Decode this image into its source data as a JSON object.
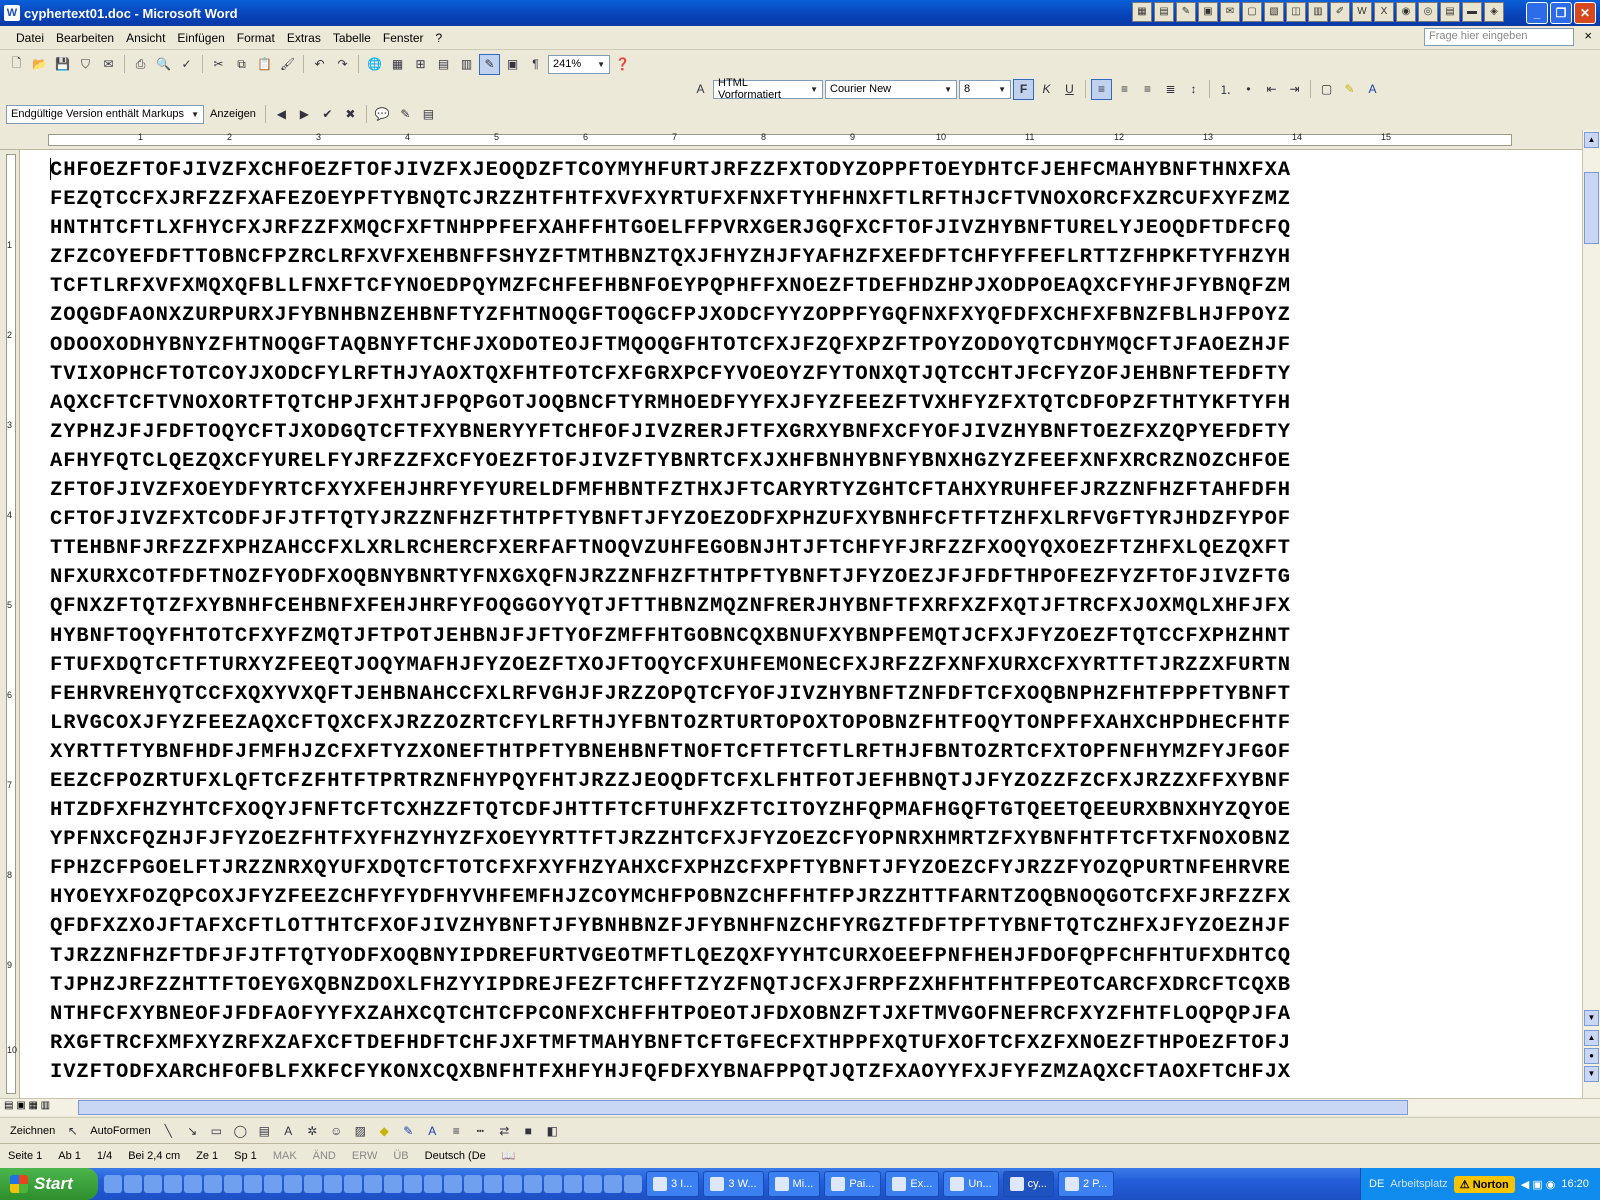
{
  "window": {
    "title": "cyphertext01.doc - Microsoft Word",
    "app_icon": "W"
  },
  "menu": [
    "Datei",
    "Bearbeiten",
    "Ansicht",
    "Einfügen",
    "Format",
    "Extras",
    "Tabelle",
    "Fenster",
    "?"
  ],
  "help": {
    "placeholder": "Frage hier eingeben",
    "close": "×"
  },
  "toolbar": {
    "zoom": "241%"
  },
  "formatting": {
    "style": "HTML Vorformatiert",
    "font": "Courier New",
    "size": "8"
  },
  "review": {
    "markup": "Endgültige Version enthält Markups",
    "show": "Anzeigen"
  },
  "ruler_numbers": [
    "1",
    "2",
    "3",
    "4",
    "5",
    "6",
    "7",
    "8",
    "9",
    "10",
    "11",
    "12",
    "13",
    "14",
    "15"
  ],
  "vruler_numbers": [
    "1",
    "2",
    "3",
    "4",
    "5",
    "6",
    "7",
    "8",
    "9",
    "10"
  ],
  "document": {
    "lines": [
      "CHFOEZFTOFJIVZFXCHFOEZFTOFJIVZFXJEOQDZFTCOYMYHFURTJRFZZFXTODYZOPPFTOEYDHTCFJEHFCMAHYBNFTHNXFXA",
      "FEZQTCCFXJRFZZFXAFEZOEYPFTYBNQTCJRZZHTFHTFXVFXYRTUFXFNXFTYHFHNXFTLRFTHJCFTVNOXORCFXZRCUFXYFZMZ",
      "HNTHTCFTLXFHYCFXJRFZZFXMQCFXFTNHPPFEFXAHFFHTGOELFFPVRXGERJGQFXCFTOFJIVZHYBNFTURELYJEOQDFTDFCFQ",
      "ZFZCOYEFDFTTOBNCFPZRCLRFXVFXEHBNFFSHYZFTMTHBNZTQXJFHYZHJFYAFHZFXEFDFTCHFYFFEFLRTTZFHPKFTYFHZYH",
      "TCFTLRFXVFXMQXQFBLLFNXFTCFYNOEDPQYMZFCHFEFHBNFOEYPQPHFFXNOEZFTDEFHDZHPJXODPOEAQXCFYHFJFYBNQFZM",
      "ZOQGDFAONXZURPURXJFYBNHBNZEHBNFTYZFHTNOQGFTOQGCFPJXODCFYYZOPPFYGQFNXFXYQFDFXCHFXFBNZFBLHJFPOYZ",
      "ODOOXODHYBNYZFHTNOQGFTAQBNYFTCHFJXODOTEOJFTMQOQGFHTOTCFXJFZQFXPZFTPOYZODOYQTCDHYMQCFTJFAOEZHJF",
      "TVIXOPHCFTOTCOYJXODCFYLRFTHJYAOXTQXFHTFOTCFXFGRXPCFYVOEOYZFYTONXQTJQTCCHTJFCFYZOFJEHBNFTEFDFTY",
      "AQXCFTCFTVNOXORTFTQTCHPJFXHTJFPQPGOTJOQBNCFTYRMHOEDFYYFXJFYZFEEZFTVXHFYZFXTQTCDFOPZFTHTYKFTYFH",
      "ZYPHZJFJFDFTOQYCFTJXODGQTCFTFXYBNERYYFTCHFOFJIVZRERJFTFXGRXYBNFXCFYOFJIVZHYBNFTOEZFXZQPYEFDFTY",
      "AFHYFQTCLQEZQXCFYURELFYJRFZZFXCFYOEZFTOFJIVZFTYBNRTCFXJXHFBNHYBNFYBNXHGZYZFEEFXNFXRCRZNOZCHFOE",
      "ZFTOFJIVZFXOEYDFYRTCFXYXFEHJHRFYFYURELDFMFHBNTFZTHXJFTCARYRTYZGHTCFTAHXYRUHFEFJRZZNFHZFTAHFDFH",
      "CFTOFJIVZFXTCODFJFJTFTQTYJRZZNFHZFTHTPFTYBNFTJFYZOEZODFXPHZUFXYBNHFCFTFTZHFXLRFVGFTYRJHDZFYPOF",
      "TTEHBNFJRFZZFXPHZAHCCFXLXRLRCHERCFXERFAFTNOQVZUHFEGOBNJHTJFTCHFYFJRFZZFXOQYQXOEZFTZHFXLQEZQXFT",
      "NFXURXCOTFDFTNOZFYODFXOQBNYBNRTYFNXGXQFNJRZZNFHZFTHTPFTYBNFTJFYZOEZJFJFDFTHPOFEZFYZFTOFJIVZFTG",
      "QFNXZFTQTZFXYBNHFCEHBNFXFEHJHRFYFOQGGOYYQTJFTTHBNZMQZNFRERJHYBNFTFXRFXZFXQTJFTRCFXJOXMQLXHFJFX",
      "HYBNFTOQYFHTOTCFXYFZMQTJFTPOTJEHBNJFJFTYOFZMFFHTGOBNCQXBNUFXYBNPFEMQTJCFXJFYZOEZFTQTCCFXPHZHNT",
      "FTUFXDQTCFTFTURXYZFEEQTJOQYMAFHJFYZOEZFTXOJFTOQYCFXUHFEMONECFXJRFZZFXNFXURXCFXYRTTFTJRZZXFURTN",
      "FEHRVREHYQTCCFXQXYVXQFTJEHBNAHCCFXLRFVGHJFJRZZOPQTCFYOFJIVZHYBNFTZNFDFTCFXOQBNPHZFHTFPPFTYBNFT",
      "LRVGCOXJFYZFEEZAQXCFTQXCFXJRZZOZRTCFYLRFTHJYFBNTOZRTURTOPOXTOPOBNZFHTFOQYTONPFFXAHXCHPDHECFHTF",
      "XYRTTFTYBNFHDFJFMFHJZCFXFTYZXONEFTHTPFTYBNEHBNFTNOFTCFTFTCFTLRFTHJFBNTOZRTCFXTOPFNFHYMZFYJFGOF",
      "EEZCFPOZRTUFXLQFTCFZFHTFTPRTRZNFHYPQYFHTJRZZJEOQDFTCFXLFHTFOTJEFHBNQTJJFYZOZZFZCFXJRZZXFFXYBNF",
      "HTZDFXFHZYHTCFXOQYJFNFTCFTCXHZZFTQTCDFJHTTFTCFTUHFXZFTCITOYZHFQPMAFHGQFTGTQEETQEEURXBNXHYZQYOE",
      "YPFNXCFQZHJFJFYZOEZFHTFXYFHZYHYZFXOEYYRTTFTJRZZHTCFXJFYZOEZCFYOPNRXHMRTZFXYBNFHTFTCFTXFNOXOBNZ",
      "FPHZCFPGOELFTJRZZNRXQYUFXDQTCFTOTCFXFXYFHZYAHXCFXPHZCFXPFTYBNFTJFYZOEZCFYJRZZFYOZQPURTNFEHRVRE",
      "HYOEYXFOZQPCOXJFYZFEEZCHFYFYDFHYVHFEMFHJZCOYMCHFPOBNZCHFFHTFPJRZZHTTFARNTZOQBNOQGOTCFXFJRFZZFX",
      "QFDFXZXOJFTAFXCFTLOTTHTCFXOFJIVZHYBNFTJFYBNHBNZFJFYBNHFNZCHFYRGZTFDFTPFTYBNFTQTCZHFXJFYZOEZHJF",
      "TJRZZNFHZFTDFJFJTFTQTYODFXOQBNYIPDREFURTVGEOTMFTLQEZQXFYYHTCURXOEEFPNFHEHJFDOFQPFCHFHTUFXDHTCQ",
      "TJPHZJRFZZHTTFTOEYGXQBNZDOXLFHZYYIPDREJFEZFTCHFFTZYZFNQTJCFXJFRPFZXHFHTFHTFPEOTCARCFXDRCFTCQXB",
      "NTHFCFXYBNEOFJFDFAOFYYFXZAHXCQTCHTCFPCONFXCHFFHTPOEOTJFDXOBNZFTJXFTMVGOFNEFRCFXYZFHTFLOQPQPJFA",
      "RXGFTRCFXMFXYZRFXZAFXCFTDEFHDFTCHFJXFTMFTMAHYBNFTCFTGFECFXTHPPFXQTUFXOFTCFXZFXNOEZFTHPOEZFTOFJ",
      "IVZFTODFXARCHFOFBLFXKFCFYKONXCQXBNFHTFXHFYHJFQFDFXYBNAFPPQTJQTZFXAOYYFXJFYFZMZAQXCFTAOXFTCHFJX"
    ]
  },
  "status": {
    "page": "Seite 1",
    "section": "Ab 1",
    "pages": "1/4",
    "at": "Bei 2,4 cm",
    "line": "Ze 1",
    "col": "Sp 1",
    "mak": "MAK",
    "aend": "ÄND",
    "erw": "ERW",
    "ueb": "ÜB",
    "lang": "Deutsch (De"
  },
  "drawing": {
    "draw": "Zeichnen",
    "autoshapes": "AutoFormen"
  },
  "taskbar": {
    "start": "Start",
    "tasks": [
      "3 I...",
      "3 W...",
      "Mi...",
      "Pai...",
      "Ex...",
      "Un...",
      "cy...",
      "2 P..."
    ],
    "lang": "DE",
    "workspace": "Arbeitsplatz",
    "norton": "Norton",
    "clock": "16:20"
  }
}
